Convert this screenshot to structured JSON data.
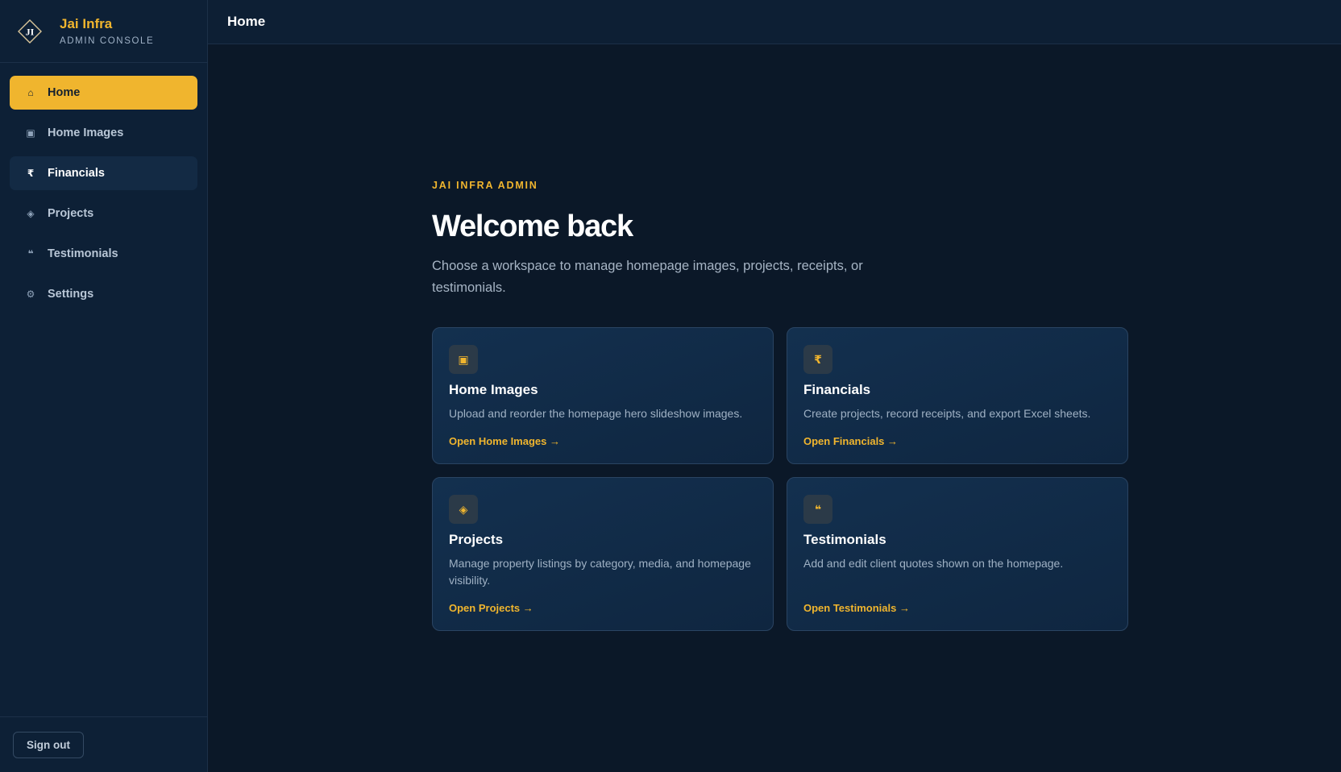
{
  "brand": {
    "logo_text": "JI",
    "name": "Jai Infra",
    "subtitle": "ADMIN CONSOLE"
  },
  "sidebar": {
    "items": [
      {
        "label": "Home",
        "icon": "⌂",
        "icon_name": "home-icon",
        "state": "active"
      },
      {
        "label": "Home Images",
        "icon": "▣",
        "icon_name": "image-icon",
        "state": "default"
      },
      {
        "label": "Financials",
        "icon": "₹",
        "icon_name": "rupee-icon",
        "state": "hover"
      },
      {
        "label": "Projects",
        "icon": "◈",
        "icon_name": "diamond-icon",
        "state": "default"
      },
      {
        "label": "Testimonials",
        "icon": "❝",
        "icon_name": "quote-icon",
        "state": "default"
      },
      {
        "label": "Settings",
        "icon": "⚙",
        "icon_name": "gear-icon",
        "state": "default"
      }
    ],
    "signout_label": "Sign out"
  },
  "header": {
    "title": "Home"
  },
  "hero": {
    "eyebrow": "JAI INFRA ADMIN",
    "title": "Welcome back",
    "description": "Choose a workspace to manage homepage images, projects, receipts, or testimonials."
  },
  "cards": [
    {
      "icon": "▣",
      "icon_name": "image-icon",
      "title": "Home Images",
      "description": "Upload and reorder the homepage hero slideshow images.",
      "link": "Open Home Images →"
    },
    {
      "icon": "₹",
      "icon_name": "rupee-icon",
      "title": "Financials",
      "description": "Create projects, record receipts, and export Excel sheets.",
      "link": "Open Financials →"
    },
    {
      "icon": "◈",
      "icon_name": "diamond-icon",
      "title": "Projects",
      "description": "Manage property listings by category, media, and homepage visibility.",
      "link": "Open Projects →"
    },
    {
      "icon": "❝",
      "icon_name": "quote-icon",
      "title": "Testimonials",
      "description": "Add and edit client quotes shown on the homepage.",
      "link": "Open Testimonials →"
    }
  ],
  "colors": {
    "accent": "#f0b52e",
    "sidebar_bg": "#0d2036",
    "page_bg": "#0b1828",
    "card_bg": "#13304f"
  }
}
